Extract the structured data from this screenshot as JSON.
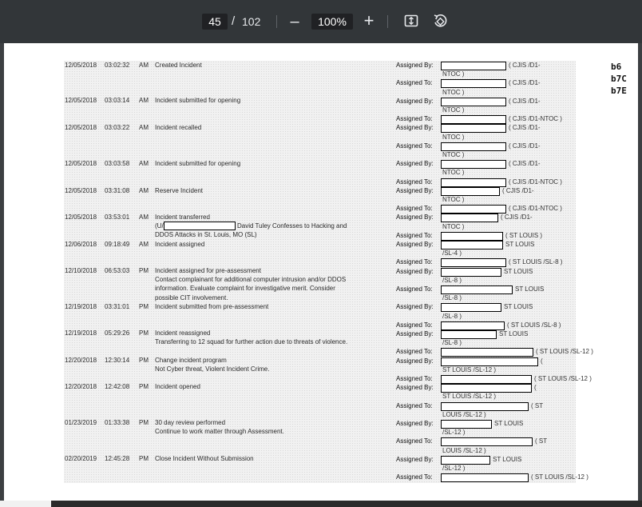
{
  "toolbar": {
    "current_page": "45",
    "separator": "/",
    "total_pages": "102",
    "zoom_out_label": "–",
    "zoom_level": "100%",
    "zoom_in_label": "+",
    "fit_icon": "fit-to-page-icon",
    "rotate_icon": "rotate-icon"
  },
  "exemptions": [
    "b6",
    "b7C",
    "b7E"
  ],
  "labels": {
    "assigned_by": "Assigned By:",
    "assigned_to": "Assigned To:"
  },
  "entries": [
    {
      "date": "12/05/2018",
      "time": "03:02:32",
      "ampm": "AM",
      "desc": [
        "Created Incident"
      ]
    },
    {
      "date": "12/05/2018",
      "time": "03:03:14",
      "ampm": "AM",
      "desc": [
        "Incident submitted for opening"
      ]
    },
    {
      "date": "12/05/2018",
      "time": "03:03:22",
      "ampm": "AM",
      "desc": [
        "Incident recalled"
      ]
    },
    {
      "date": "12/05/2018",
      "time": "03:03:58",
      "ampm": "AM",
      "desc": [
        "Incident submitted for opening"
      ]
    },
    {
      "date": "12/05/2018",
      "time": "03:31:08",
      "ampm": "AM",
      "desc": [
        "Reserve Incident"
      ]
    },
    {
      "date": "12/05/2018",
      "time": "03:53:01",
      "ampm": "AM",
      "desc": [
        "Incident transferred",
        "(U/",
        "David Tuley Confesses to Hacking and",
        "DDOS Attacks in St. Louis, MO (SL)"
      ]
    },
    {
      "date": "12/06/2018",
      "time": "09:18:49",
      "ampm": "AM",
      "desc": [
        "Incident assigned"
      ]
    },
    {
      "date": "12/10/2018",
      "time": "06:53:03",
      "ampm": "PM",
      "desc": [
        "Incident assigned for pre-assessment",
        "Contact complainant for additional computer intrusion and/or DDOS",
        "information. Evaluate complaint for investigative merit. Consider",
        "possible CIT involvement."
      ]
    },
    {
      "date": "12/19/2018",
      "time": "03:31:01",
      "ampm": "PM",
      "desc": [
        "Incident submitted from pre-assessment"
      ]
    },
    {
      "date": "12/19/2018",
      "time": "05:29:26",
      "ampm": "PM",
      "desc": [
        "Incident reassigned",
        "Transferring to 12 squad for further action due to threats of violence."
      ]
    },
    {
      "date": "12/20/2018",
      "time": "12:30:14",
      "ampm": "PM",
      "desc": [
        "Change incident program",
        "Not Cyber threat, Violent Incident Crime."
      ]
    },
    {
      "date": "12/20/2018",
      "time": "12:42:08",
      "ampm": "PM",
      "desc": [
        "Incident opened"
      ]
    },
    {
      "date": "01/23/2019",
      "time": "01:33:38",
      "ampm": "PM",
      "desc": [
        "30 day review performed",
        "Continue to work matter through Assessment."
      ]
    },
    {
      "date": "02/20/2019",
      "time": "12:45:28",
      "ampm": "PM",
      "desc": [
        "Close Incident Without Submission"
      ]
    }
  ],
  "assign_rows": [
    {
      "kind": "assigned_by",
      "after": "( CJIS /D1-"
    },
    {
      "kind": "text",
      "text": "NTOC )"
    },
    {
      "kind": "assigned_to",
      "after": "( CJIS /D1-"
    },
    {
      "kind": "text",
      "text": "NTOC )"
    },
    {
      "kind": "assigned_by",
      "after": "( CJIS /D1-"
    },
    {
      "kind": "text",
      "text": "NTOC )"
    },
    {
      "kind": "assigned_to",
      "after": "( CJIS /D1-NTOC )"
    },
    {
      "kind": "assigned_by",
      "after": "( CJIS /D1-"
    },
    {
      "kind": "text",
      "text": "NTOC )"
    },
    {
      "kind": "assigned_to",
      "after": "( CJIS /D1-"
    },
    {
      "kind": "text",
      "text": "NTOC )"
    },
    {
      "kind": "assigned_by",
      "after": "( CJIS /D1-"
    },
    {
      "kind": "text",
      "text": "NTOC )"
    },
    {
      "kind": "assigned_to",
      "after": "( CJIS /D1-NTOC )"
    },
    {
      "kind": "assigned_by",
      "after": "( CJIS /D1-"
    },
    {
      "kind": "text",
      "text": "NTOC )"
    },
    {
      "kind": "assigned_to",
      "after": "( CJIS /D1-NTOC )"
    },
    {
      "kind": "assigned_by",
      "after": "( CJIS /D1-"
    },
    {
      "kind": "text",
      "text": "NTOC )"
    },
    {
      "kind": "assigned_to",
      "after": "( ST LOUIS )"
    },
    {
      "kind": "assigned_by",
      "after": "ST LOUIS"
    },
    {
      "kind": "text",
      "text": "/SL-4 )"
    },
    {
      "kind": "assigned_to",
      "after": "( ST LOUIS /SL-8 )"
    },
    {
      "kind": "assigned_by",
      "after": "ST LOUIS"
    },
    {
      "kind": "text",
      "text": "/SL-8 )"
    },
    {
      "kind": "assigned_to",
      "after": "ST LOUIS"
    },
    {
      "kind": "text",
      "text": "/SL-8 )"
    },
    {
      "kind": "assigned_by",
      "after": "ST LOUIS"
    },
    {
      "kind": "text",
      "text": "/SL-8 )"
    },
    {
      "kind": "assigned_to",
      "after": "( ST LOUIS /SL-8 )"
    },
    {
      "kind": "assigned_by",
      "after": "ST LOUIS"
    },
    {
      "kind": "text",
      "text": "/SL-8 )"
    },
    {
      "kind": "assigned_to",
      "after": "( ST LOUIS /SL-12 )"
    },
    {
      "kind": "assigned_by",
      "after": "("
    },
    {
      "kind": "text",
      "text": "ST LOUIS /SL-12 )"
    },
    {
      "kind": "assigned_to",
      "after": "( ST LOUIS /SL-12 )"
    },
    {
      "kind": "assigned_by",
      "after": "("
    },
    {
      "kind": "text",
      "text": "ST LOUIS /SL-12 )"
    },
    {
      "kind": "assigned_to",
      "after": "( ST"
    },
    {
      "kind": "text",
      "text": "LOUIS /SL-12 )"
    },
    {
      "kind": "assigned_by",
      "after": "ST LOUIS"
    },
    {
      "kind": "text",
      "text": "/SL-12 )"
    },
    {
      "kind": "assigned_to",
      "after": "( ST"
    },
    {
      "kind": "text",
      "text": "LOUIS /SL-12 )"
    },
    {
      "kind": "assigned_by",
      "after": "ST LOUIS"
    },
    {
      "kind": "text",
      "text": "/SL-12 )"
    },
    {
      "kind": "assigned_to",
      "after": "( ST LOUIS /SL-12 )"
    }
  ]
}
